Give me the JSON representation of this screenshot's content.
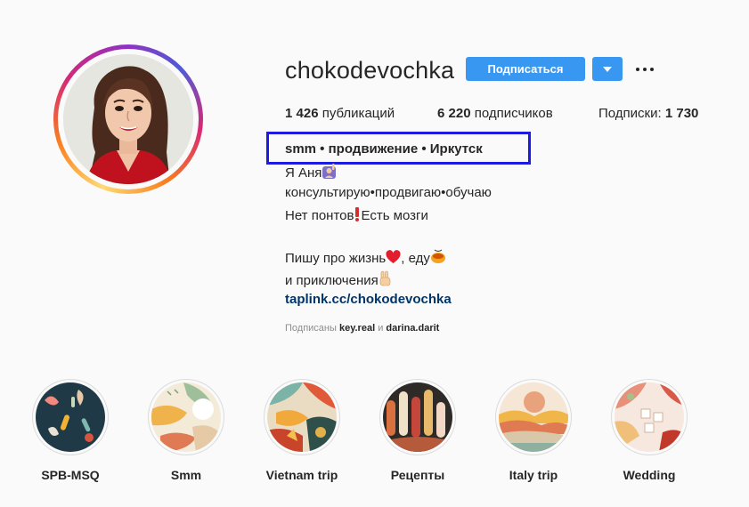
{
  "profile": {
    "username": "chokodevochka",
    "follow_label": "Подписаться",
    "stats": {
      "posts_count": "1 426",
      "posts_label": "публикаций",
      "followers_count": "6 220",
      "followers_label": "подписчиков",
      "following_label": "Подписки:",
      "following_count": "1 730"
    },
    "bio": {
      "title": "smm • продвижение • Иркутск",
      "line1": "Я Аня",
      "line2": "консультирую•продвигаю•обучаю",
      "line3a": "Нет понтов",
      "line3b": "Есть мозги",
      "line4a": "Пишу про жизнь",
      "line4b": ", еду",
      "line5": "и приключения",
      "link": "taplink.cc/chokodevochka"
    },
    "followed_by": {
      "prefix": "Подписаны",
      "user1": "key.real",
      "joiner": "и",
      "user2": "darina.darit"
    }
  },
  "highlights": [
    {
      "label": "SPB-MSQ"
    },
    {
      "label": "Smm"
    },
    {
      "label": "Vietnam trip"
    },
    {
      "label": "Рецепты"
    },
    {
      "label": "Italy trip"
    },
    {
      "label": "Wedding"
    }
  ],
  "colors": {
    "accent": "#3897f0",
    "link": "#003569",
    "highlight_box": "#1c1ce0"
  }
}
